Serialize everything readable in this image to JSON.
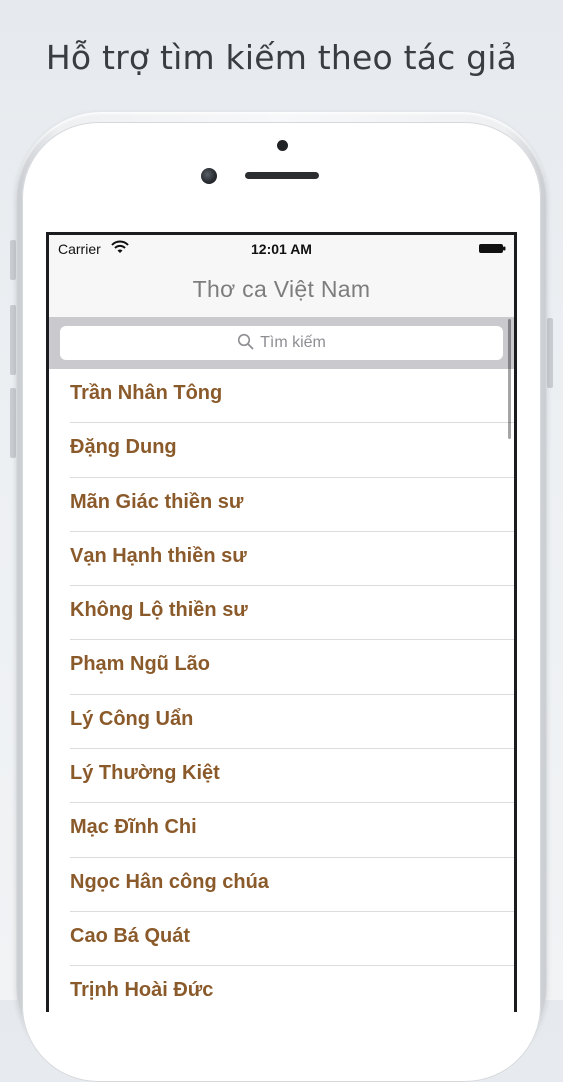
{
  "promo": {
    "headline": "Hỗ trợ tìm kiếm theo tác giả"
  },
  "status_bar": {
    "carrier": "Carrier",
    "time": "12:01 AM",
    "wifi_icon": "wifi-icon",
    "battery_icon": "battery-icon"
  },
  "nav": {
    "title": "Thơ ca Việt Nam"
  },
  "search": {
    "placeholder": "Tìm kiếm",
    "icon": "search-icon"
  },
  "authors": [
    "Trần Nhân Tông",
    "Đặng Dung",
    "Mãn Giác thiền sư",
    "Vạn Hạnh thiền sư",
    "Không Lộ thiền sư",
    "Phạm Ngũ Lão",
    "Lý Công Uẩn",
    "Lý Thường Kiệt",
    "Mạc Đĩnh Chi",
    "Ngọc Hân công chúa",
    "Cao Bá Quát",
    "Trịnh Hoài Đức"
  ],
  "colors": {
    "author_text": "#8b5a2b",
    "title_text": "#7d7d7d",
    "search_bar_bg": "#c9c9ce"
  }
}
